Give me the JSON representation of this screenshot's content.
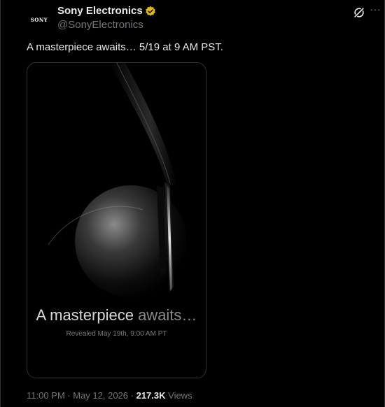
{
  "author": {
    "avatar_text": "SONY",
    "display_name": "Sony Electronics",
    "handle": "@SonyElectronics",
    "verified_color": "#e2b719"
  },
  "actions": {
    "grok_icon": "grok-icon",
    "more_label": "···"
  },
  "tweet": {
    "text": "A masterpiece awaits… 5/19 at 9 AM PST."
  },
  "media": {
    "headline_main": "A masterpiece",
    "headline_fade": " awaits…",
    "subline": "Revealed May 19th, 9:00 AM PT"
  },
  "meta": {
    "time": "11:00 PM",
    "sep1": " · ",
    "date": "May 12, 2026",
    "sep2": " · ",
    "views_count": "217.3K",
    "views_label": " Views"
  }
}
